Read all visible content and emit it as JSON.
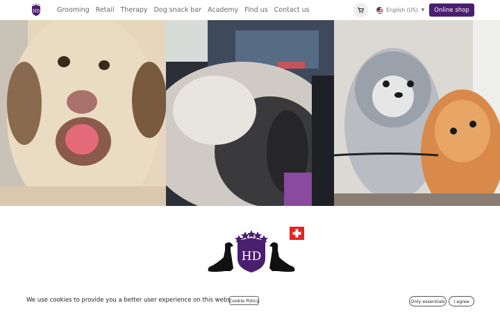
{
  "navbar": {
    "logo_text": "HD",
    "links": [
      "Grooming",
      "Retail",
      "Therapy",
      "Dog snack bar",
      "Academy",
      "Find us",
      "Contact us"
    ],
    "cart_icon": "cart-icon",
    "language": "English (US)",
    "shop_label": "Online shop"
  },
  "brand": {
    "monogram": "HD",
    "badge": "swiss-flag"
  },
  "cookie": {
    "message": "We use cookies to provide you a better user experience on this website.",
    "policy_label": "Cookie Policy",
    "essentials_label": "Only essentials",
    "agree_label": "I agree"
  },
  "colors": {
    "brand_purple": "#4a1f6e",
    "swiss_red": "#e52521"
  }
}
